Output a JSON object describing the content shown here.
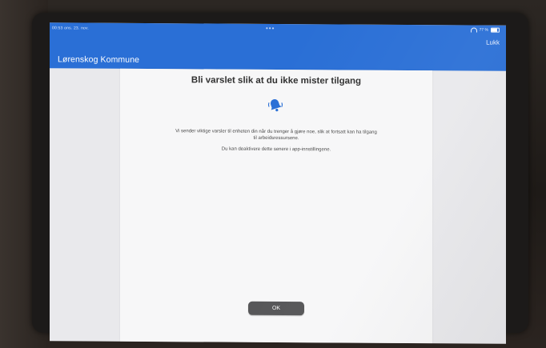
{
  "status_bar": {
    "time_date": "00:53  ons. 23. nov.",
    "dots": "•••",
    "battery": "77 %"
  },
  "header": {
    "close_label": "Lukk",
    "org_title": "Lørenskog Kommune"
  },
  "dialog": {
    "title": "Bli varslet slik at du ikke mister tilgang",
    "icon": "bell-icon",
    "body_line_1": "Vi sender viktige varsler til enheten din når du trenger å gjøre noe, slik at fortsatt kan ha tilgang",
    "body_line_2": "til arbeidsressursene.",
    "body_secondary": "Du kan deaktivere dette senere i app-innstillingene.",
    "ok_label": "OK"
  },
  "colors": {
    "header_blue": "#2a6fd6",
    "bell_blue": "#2a6fd6",
    "ok_button": "#525254"
  }
}
